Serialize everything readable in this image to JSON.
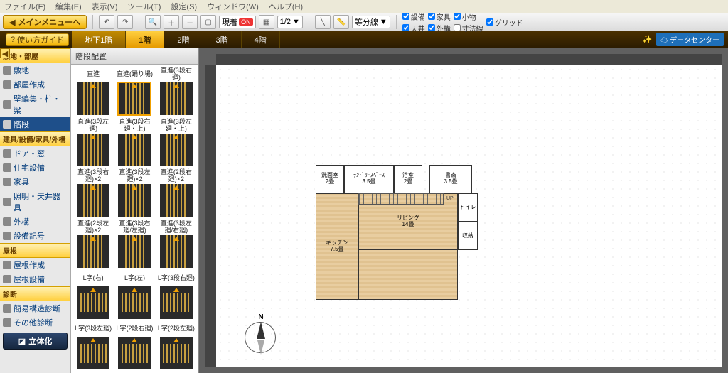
{
  "menu": {
    "file": "ファイル(F)",
    "edit": "編集(E)",
    "view": "表示(V)",
    "tool": "ツール(T)",
    "setting": "設定(S)",
    "window": "ウィンドウ(W)",
    "help": "ヘルプ(H)"
  },
  "toolbar": {
    "main_menu": "メインメニューへ",
    "genko": "現着",
    "on": "ON",
    "scale": "1/2",
    "line_mode": "等分線",
    "checks": {
      "c1": "設備",
      "c2": "天井",
      "c3": "家具",
      "c4": "外構",
      "c5": "小物",
      "c6": "寸法線",
      "c7": "グリッド"
    }
  },
  "floortabs": {
    "help": "使い方ガイド",
    "b1": "地下1階",
    "f1": "1階",
    "f2": "2階",
    "f3": "3階",
    "f4": "4階",
    "wiz": "",
    "datacenter": "データセンター"
  },
  "sidebar": {
    "g1": "敷地・部屋",
    "i1": "敷地",
    "i2": "部屋作成",
    "i3": "壁編集・柱・梁",
    "i4": "階段",
    "g2": "建具/設備/家具/外構",
    "i5": "ドア・窓",
    "i6": "住宅設備",
    "i7": "家具",
    "i8": "照明・天井器具",
    "i9": "外構",
    "i10": "設備記号",
    "g3": "屋根",
    "i11": "屋根作成",
    "i12": "屋根設備",
    "g4": "診断",
    "i13": "簡易構造診断",
    "i14": "その他診断",
    "build3d": "立体化"
  },
  "palette": {
    "title": "階段配置",
    "items": [
      "直進",
      "直進(踊り場)",
      "直進(3段右廻)",
      "直進(3段左廻)",
      "直進(3段右廻・上)",
      "直進(3段左廻・上)",
      "直進(3段右廻)×2",
      "直進(3段左廻)×2",
      "直進(2段右廻)×2",
      "直進(2段左廻)×2",
      "直進(3段右廻/左廻)",
      "直進(3段左廻/右廻)",
      "L字(右)",
      "L字(左)",
      "L字(3段右廻)",
      "L字(3段左廻)",
      "L字(2段右廻)",
      "L字(2段左廻)"
    ],
    "selected_index": 1
  },
  "rooms": {
    "r1": {
      "name": "洗面室",
      "size": "2畳"
    },
    "r2": {
      "name": "ﾗﾝﾄﾞﾘｰｽﾍﾟｰｽ",
      "size": "3.5畳"
    },
    "r3": {
      "name": "浴室",
      "size": "2畳"
    },
    "r4": {
      "name": "書斎",
      "size": "3.5畳"
    },
    "r5": {
      "name": "トイレ",
      "size": ""
    },
    "r6": {
      "name": "収納",
      "size": ""
    },
    "r7": {
      "name": "リビング",
      "size": "14畳"
    },
    "r8": {
      "name": "キッチン",
      "size": "7.5畳"
    },
    "up": "UP"
  },
  "compass": {
    "n": "N"
  }
}
